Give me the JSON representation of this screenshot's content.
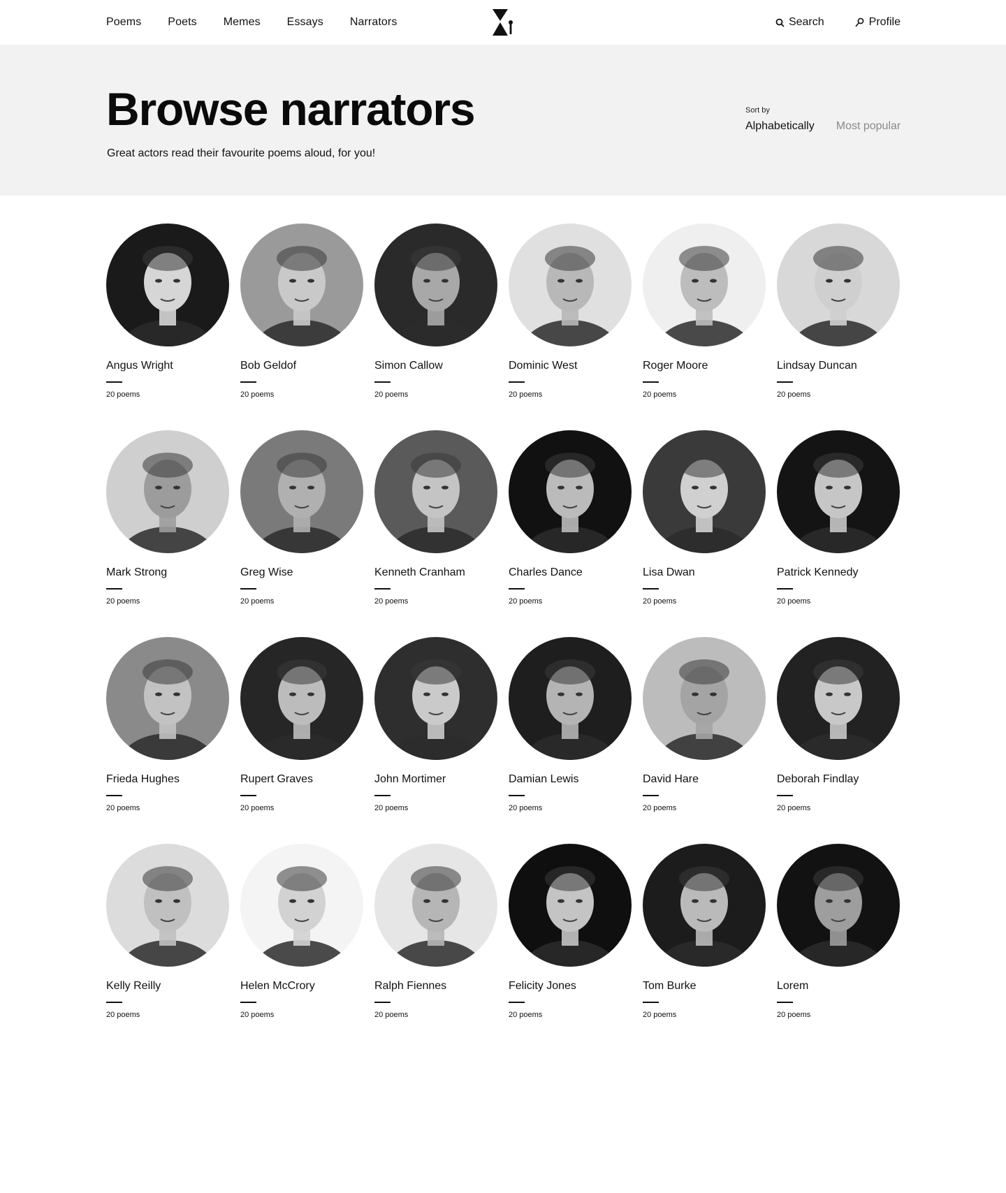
{
  "nav": {
    "links": [
      "Poems",
      "Poets",
      "Memes",
      "Essays",
      "Narrators"
    ],
    "search_label": "Search",
    "profile_label": "Profile"
  },
  "hero": {
    "title": "Browse narrators",
    "subtitle": "Great actors read their favourite poems aloud, for you!",
    "sort_label": "Sort by",
    "sort_options": [
      "Alphabetically",
      "Most popular"
    ],
    "sort_selected": "Alphabetically"
  },
  "narrators": [
    {
      "name": "Angus Wright",
      "count": "20 poems",
      "tone": "#1a1a1a",
      "face": "#d6d6d6"
    },
    {
      "name": "Bob Geldof",
      "count": "20 poems",
      "tone": "#9a9a9a",
      "face": "#c9c9c9"
    },
    {
      "name": "Simon Callow",
      "count": "20 poems",
      "tone": "#2a2a2a",
      "face": "#a8a8a8"
    },
    {
      "name": "Dominic West",
      "count": "20 poems",
      "tone": "#e0e0e0",
      "face": "#b8b8b8"
    },
    {
      "name": "Roger Moore",
      "count": "20 poems",
      "tone": "#efefef",
      "face": "#bdbdbd"
    },
    {
      "name": "Lindsay Duncan",
      "count": "20 poems",
      "tone": "#d8d8d8",
      "face": "#cfcfcf"
    },
    {
      "name": "Mark Strong",
      "count": "20 poems",
      "tone": "#cfcfcf",
      "face": "#9c9c9c"
    },
    {
      "name": "Greg Wise",
      "count": "20 poems",
      "tone": "#7a7a7a",
      "face": "#b0b0b0"
    },
    {
      "name": "Kenneth Cranham",
      "count": "20 poems",
      "tone": "#5a5a5a",
      "face": "#c4c4c4"
    },
    {
      "name": "Charles Dance",
      "count": "20 poems",
      "tone": "#111111",
      "face": "#bbbbbb"
    },
    {
      "name": "Lisa Dwan",
      "count": "20 poems",
      "tone": "#3a3a3a",
      "face": "#d0d0d0"
    },
    {
      "name": "Patrick Kennedy",
      "count": "20 poems",
      "tone": "#141414",
      "face": "#c6c6c6"
    },
    {
      "name": "Frieda Hughes",
      "count": "20 poems",
      "tone": "#8a8a8a",
      "face": "#c2c2c2"
    },
    {
      "name": "Rupert Graves",
      "count": "20 poems",
      "tone": "#262626",
      "face": "#bcbcbc"
    },
    {
      "name": "John Mortimer",
      "count": "20 poems",
      "tone": "#2e2e2e",
      "face": "#cacaca"
    },
    {
      "name": "Damian Lewis",
      "count": "20 poems",
      "tone": "#1e1e1e",
      "face": "#b4b4b4"
    },
    {
      "name": "David Hare",
      "count": "20 poems",
      "tone": "#bcbcbc",
      "face": "#a4a4a4"
    },
    {
      "name": "Deborah Findlay",
      "count": "20 poems",
      "tone": "#222222",
      "face": "#c8c8c8"
    },
    {
      "name": "Kelly Reilly",
      "count": "20 poems",
      "tone": "#dcdcdc",
      "face": "#c0c0c0"
    },
    {
      "name": "Helen McCrory",
      "count": "20 poems",
      "tone": "#f4f4f4",
      "face": "#d2d2d2"
    },
    {
      "name": "Ralph Fiennes",
      "count": "20 poems",
      "tone": "#e6e6e6",
      "face": "#b6b6b6"
    },
    {
      "name": "Felicity Jones",
      "count": "20 poems",
      "tone": "#0f0f0f",
      "face": "#c4c4c4"
    },
    {
      "name": "Tom Burke",
      "count": "20 poems",
      "tone": "#1c1c1c",
      "face": "#bababa"
    },
    {
      "name": "Lorem",
      "count": "20 poems",
      "tone": "#121212",
      "face": "#9e9e9e"
    }
  ]
}
